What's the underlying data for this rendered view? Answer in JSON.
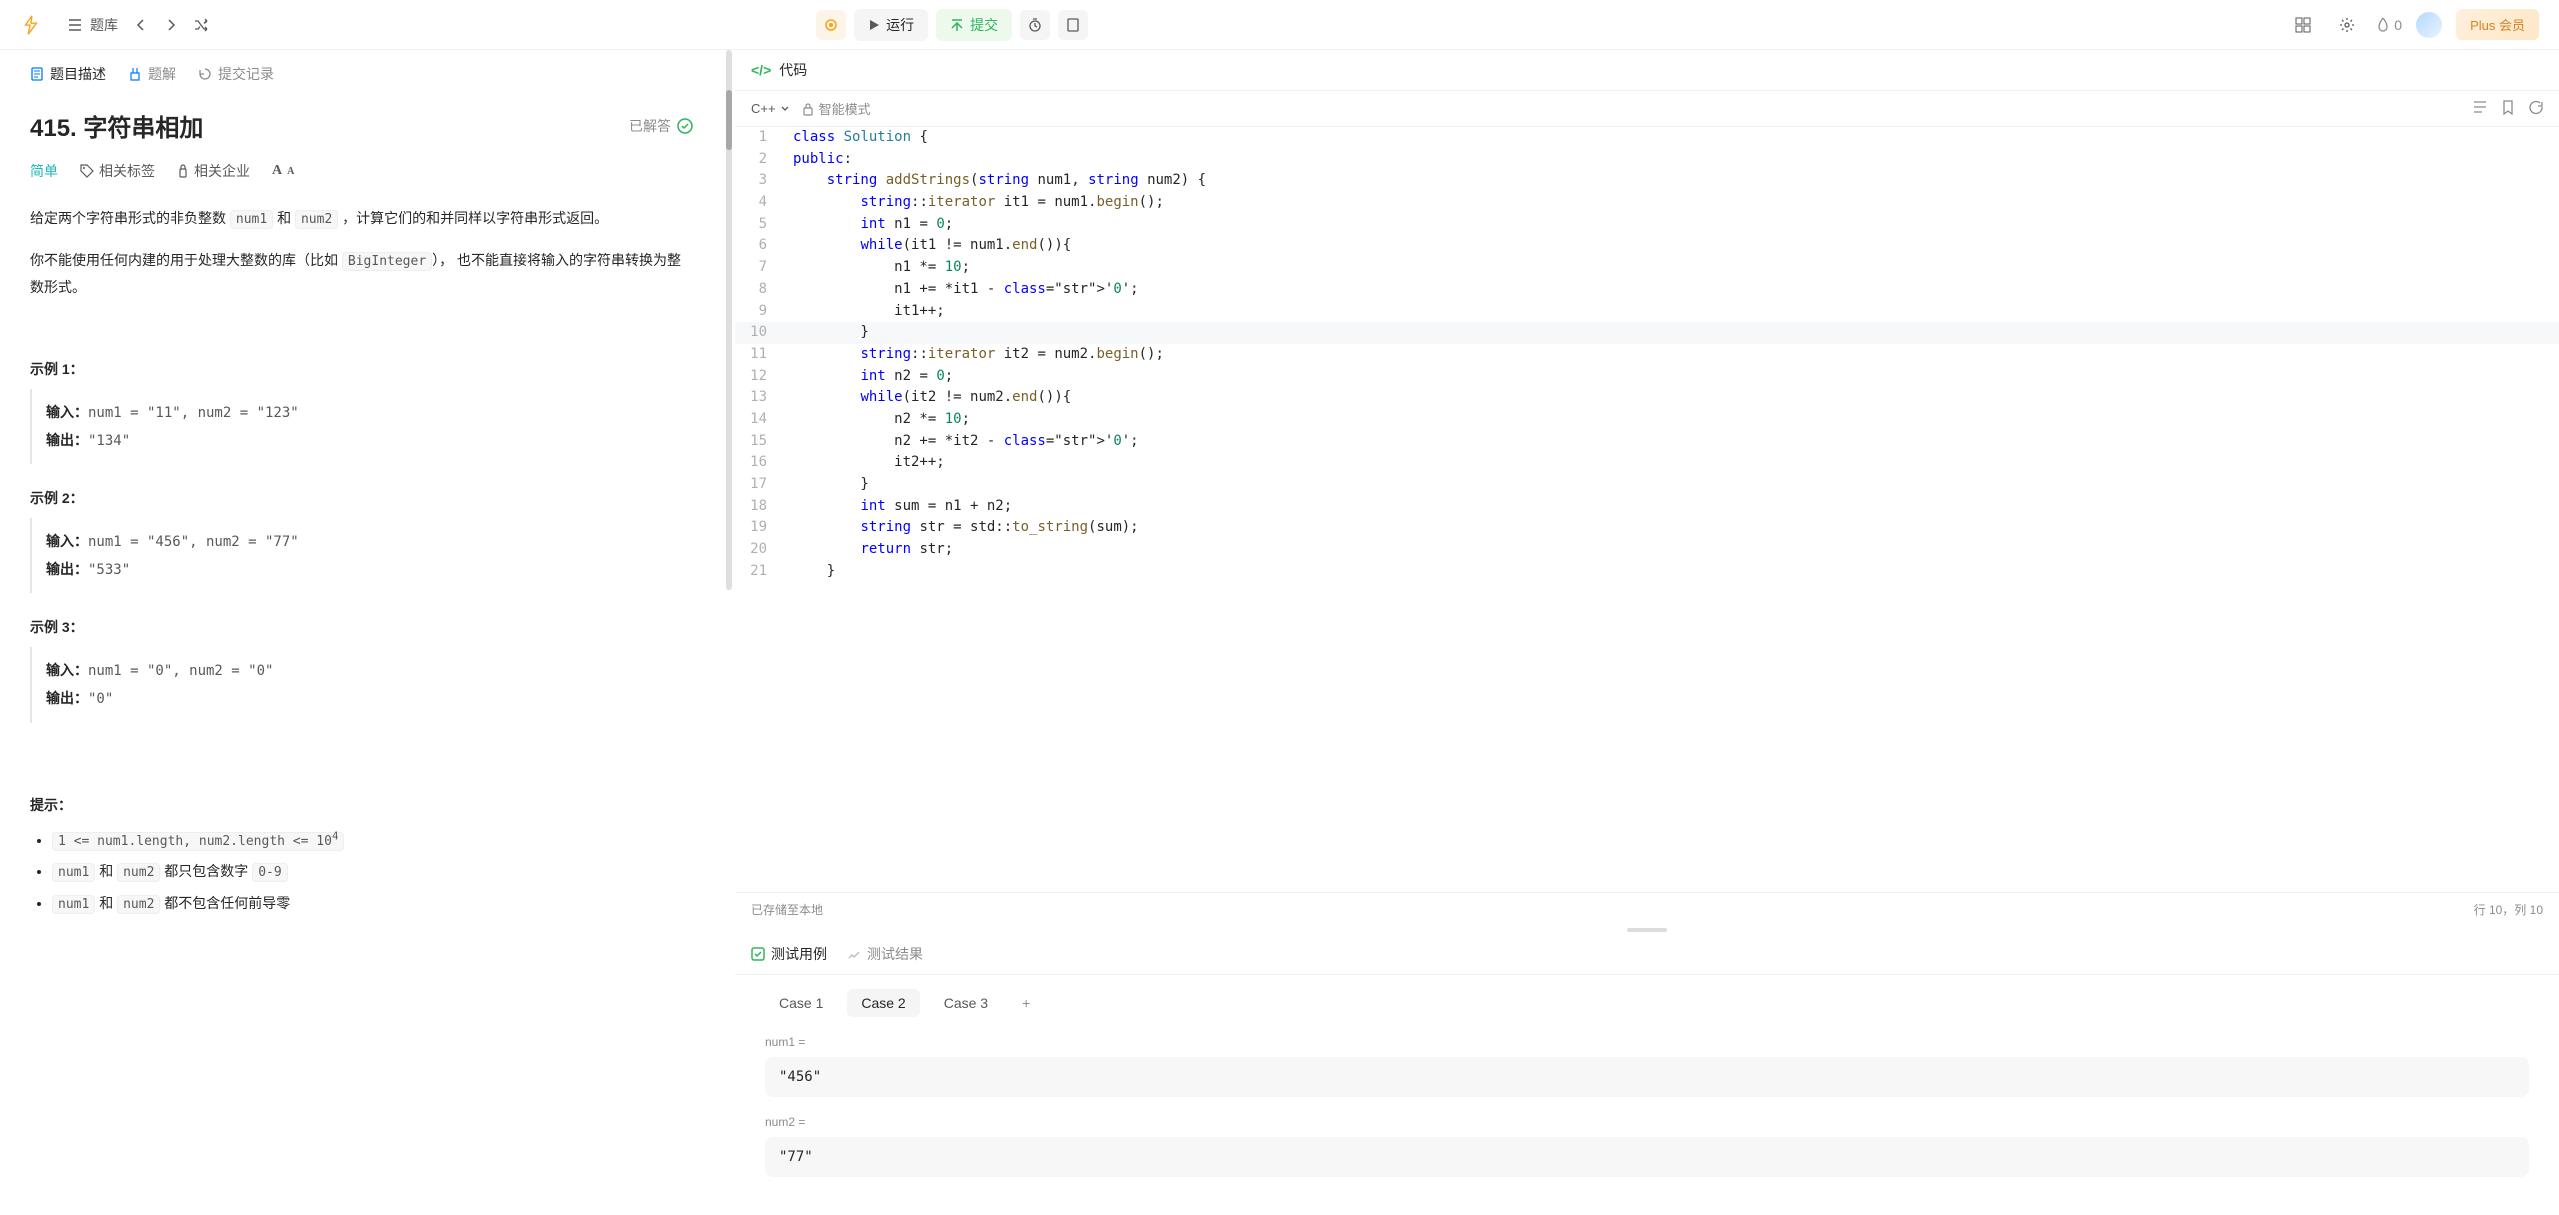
{
  "topbar": {
    "problems_label": "题库",
    "run_label": "运行",
    "submit_label": "提交",
    "fire_count": "0",
    "plus_label": "Plus 会员"
  },
  "tabs": {
    "desc": "题目描述",
    "solution": "题解",
    "submissions": "提交记录"
  },
  "problem": {
    "title": "415. 字符串相加",
    "solved_label": "已解答",
    "difficulty": "简单",
    "tags_label": "相关标签",
    "companies_label": "相关企业",
    "desc1_a": "给定两个字符串形式的非负整数 ",
    "desc1_code1": "num1",
    "desc1_b": " 和 ",
    "desc1_code2": "num2",
    "desc1_c": " ，计算它们的和并同样以字符串形式返回。",
    "desc2_a": "你不能使用任何内建的用于处理大整数的库（比如 ",
    "desc2_code": "BigInteger",
    "desc2_b": "）， 也不能直接将输入的字符串转换为整数形式。",
    "example1_title": "示例 1：",
    "example2_title": "示例 2：",
    "example3_title": "示例 3：",
    "input_label": "输入：",
    "output_label": "输出：",
    "ex1_in": "num1 = \"11\", num2 = \"123\"",
    "ex1_out": "\"134\"",
    "ex2_in": "num1 = \"456\", num2 = \"77\"",
    "ex2_out": "\"533\"",
    "ex3_in": "num1 = \"0\", num2 = \"0\"",
    "ex3_out": "\"0\"",
    "hints_title": "提示：",
    "hint1_code": "1 <= num1.length, num2.length <= 10",
    "hint1_sup": "4",
    "hint2_code1": "num1",
    "hint2_mid": " 和 ",
    "hint2_code2": "num2",
    "hint2_tail": " 都只包含数字 ",
    "hint2_code3": "0-9",
    "hint3_code1": "num1",
    "hint3_mid": " 和 ",
    "hint3_code2": "num2",
    "hint3_tail": " 都不包含任何前导零"
  },
  "code": {
    "header_label": "代码",
    "language": "C++",
    "smart_mode": "智能模式",
    "saved_label": "已存储至本地",
    "cursor_pos": "行 10，列 10",
    "lines": [
      {
        "n": "1",
        "raw": "class Solution {"
      },
      {
        "n": "2",
        "raw": "public:"
      },
      {
        "n": "3",
        "raw": "    string addStrings(string num1, string num2) {"
      },
      {
        "n": "4",
        "raw": "        string::iterator it1 = num1.begin();"
      },
      {
        "n": "5",
        "raw": "        int n1 = 0;"
      },
      {
        "n": "6",
        "raw": "        while(it1 != num1.end()){"
      },
      {
        "n": "7",
        "raw": "            n1 *= 10;"
      },
      {
        "n": "8",
        "raw": "            n1 += *it1 - '0';"
      },
      {
        "n": "9",
        "raw": "            it1++;"
      },
      {
        "n": "10",
        "raw": "        }"
      },
      {
        "n": "11",
        "raw": "        string::iterator it2 = num2.begin();"
      },
      {
        "n": "12",
        "raw": "        int n2 = 0;"
      },
      {
        "n": "13",
        "raw": "        while(it2 != num2.end()){"
      },
      {
        "n": "14",
        "raw": "            n2 *= 10;"
      },
      {
        "n": "15",
        "raw": "            n2 += *it2 - '0';"
      },
      {
        "n": "16",
        "raw": "            it2++;"
      },
      {
        "n": "17",
        "raw": "        }"
      },
      {
        "n": "18",
        "raw": "        int sum = n1 + n2;"
      },
      {
        "n": "19",
        "raw": "        string str = std::to_string(sum);"
      },
      {
        "n": "20",
        "raw": "        return str;"
      },
      {
        "n": "21",
        "raw": "    }"
      }
    ]
  },
  "test": {
    "testcase_label": "测试用例",
    "result_label": "测试结果",
    "case1": "Case 1",
    "case2": "Case 2",
    "case3": "Case 3",
    "num1_label": "num1 =",
    "num1_value": "\"456\"",
    "num2_label": "num2 =",
    "num2_value": "\"77\""
  }
}
